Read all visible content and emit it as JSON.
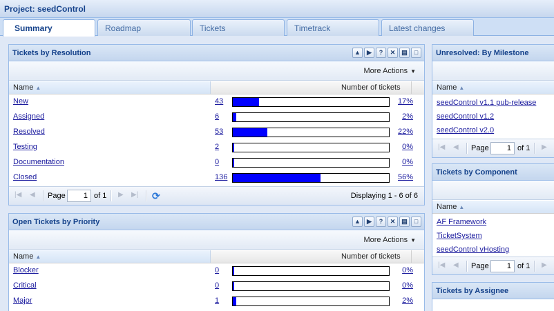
{
  "project": {
    "title": "Project: seedControl"
  },
  "tabs": [
    {
      "label": "Summary"
    },
    {
      "label": "Roadmap"
    },
    {
      "label": "Tickets"
    },
    {
      "label": "Timetrack"
    },
    {
      "label": "Latest changes"
    }
  ],
  "resolution": {
    "title": "Tickets by Resolution",
    "more_actions": "More Actions",
    "col_name": "Name",
    "col_count": "Number of tickets",
    "rows": [
      {
        "name": "New",
        "count": "43",
        "pct": "17%",
        "fraction": 0.17
      },
      {
        "name": "Assigned",
        "count": "6",
        "pct": "2%",
        "fraction": 0.02
      },
      {
        "name": "Resolved",
        "count": "53",
        "pct": "22%",
        "fraction": 0.22
      },
      {
        "name": "Testing",
        "count": "2",
        "pct": "0%",
        "fraction": 0.0
      },
      {
        "name": "Documentation",
        "count": "0",
        "pct": "0%",
        "fraction": 0.0
      },
      {
        "name": "Closed",
        "count": "136",
        "pct": "56%",
        "fraction": 0.56
      }
    ],
    "pager": {
      "page_label": "Page",
      "page_value": "1",
      "of_label": "of 1",
      "displaying": "Displaying 1 - 6 of 6"
    }
  },
  "priority": {
    "title": "Open Tickets by Priority",
    "more_actions": "More Actions",
    "col_name": "Name",
    "col_count": "Number of tickets",
    "rows": [
      {
        "name": "Blocker",
        "count": "0",
        "pct": "0%",
        "fraction": 0.0
      },
      {
        "name": "Critical",
        "count": "0",
        "pct": "0%",
        "fraction": 0.0
      },
      {
        "name": "Major",
        "count": "1",
        "pct": "2%",
        "fraction": 0.02
      }
    ]
  },
  "milestone": {
    "title": "Unresolved: By Milestone",
    "col_name": "Name",
    "items": [
      "seedControl v1.1 pub-release",
      "seedControl v1.2",
      "seedControl v2.0"
    ],
    "pager": {
      "page_label": "Page",
      "page_value": "1",
      "of_label": "of 1"
    }
  },
  "component": {
    "title": "Tickets by Component",
    "col_name": "Name",
    "items": [
      "AF Framework",
      "TicketSystem",
      "seedControl vHosting"
    ],
    "pager": {
      "page_label": "Page",
      "page_value": "1",
      "of_label": "of 1"
    }
  },
  "assignee": {
    "title": "Tickets by Assignee"
  },
  "colors": {
    "bar_fill": "#0000ff",
    "header_text": "#15428b",
    "link": "#1a1a9e"
  },
  "icons": {
    "panel_tools": [
      "arrow-up-icon",
      "arrow-right-icon",
      "help-icon",
      "close-icon",
      "print-icon",
      "maximize-icon"
    ],
    "pager": [
      "first-page-icon",
      "prev-page-icon",
      "next-page-icon",
      "last-page-icon",
      "refresh-icon"
    ]
  }
}
